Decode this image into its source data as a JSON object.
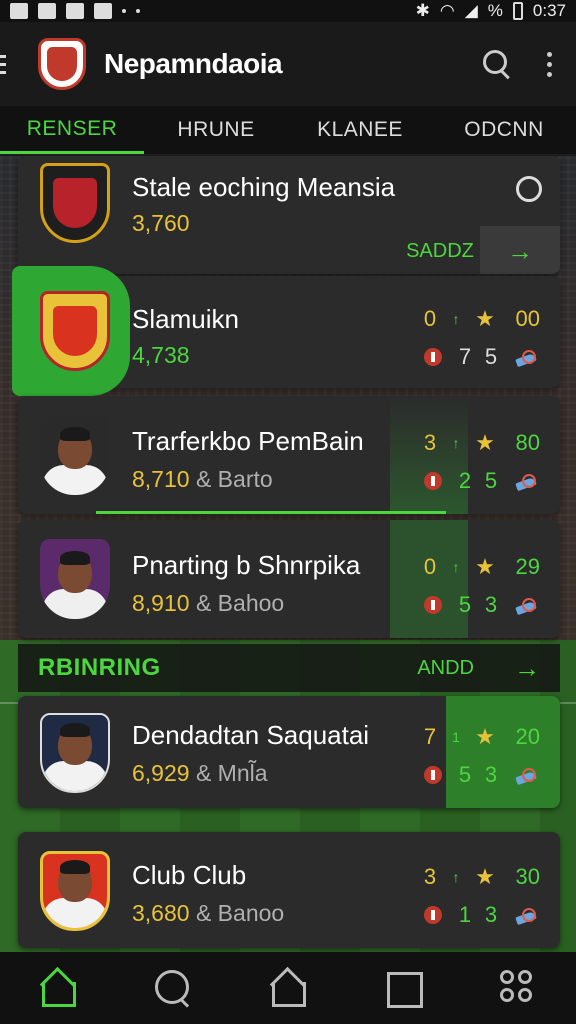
{
  "status_bar": {
    "time": "0:37",
    "battery_glyph": "%"
  },
  "app": {
    "title": "Nepamndaoia"
  },
  "colors": {
    "accent": "#4cd640",
    "gold": "#e8c33a",
    "card": "#2b2b2b",
    "red": "#c0392b"
  },
  "tabs": [
    {
      "label": "RENSER",
      "active": true
    },
    {
      "label": "HRUNE",
      "active": false
    },
    {
      "label": "KLANEE",
      "active": false
    },
    {
      "label": "ODCNN",
      "active": false
    }
  ],
  "cards": [
    {
      "name": "Stale eoching Meansia",
      "value": "3,760",
      "extra": "",
      "action_label": "SADDZ",
      "action_arrow": "→"
    },
    {
      "name": "Slamuikn",
      "value": "4,738",
      "extra": "",
      "top": {
        "a": "0",
        "b": "↑",
        "c": "00"
      },
      "bottom": {
        "a": "7",
        "b": "5"
      }
    },
    {
      "name": "Trarferkbo PemBain",
      "value": "8,710",
      "extra": "& Barto",
      "top": {
        "a": "3",
        "b": "↑",
        "c": "80"
      },
      "bottom": {
        "a": "2",
        "b": "5"
      }
    },
    {
      "name": "Pnarting b Shnrpika",
      "value": "8,910",
      "extra": "& Bahoo",
      "top": {
        "a": "0",
        "b": "↑",
        "c": "29"
      },
      "bottom": {
        "a": "5",
        "b": "3"
      }
    },
    {
      "name": "Dendadtan Saquatai",
      "value": "6,929",
      "extra": "& Mnl̃a",
      "top": {
        "a": "7",
        "b": "1",
        "c": "20"
      },
      "bottom": {
        "a": "5",
        "b": "3"
      }
    },
    {
      "name": "Club Club",
      "value": "3,680",
      "extra": "& Banoo",
      "top": {
        "a": "3",
        "b": "↑",
        "c": "30"
      },
      "bottom": {
        "a": "1",
        "b": "3"
      }
    }
  ],
  "section": {
    "title": "RBINRING",
    "action": "ANDD",
    "arrow": "→"
  },
  "star_glyph": "★",
  "bottom_nav": [
    "home-icon",
    "search-icon",
    "home-icon",
    "square-icon",
    "apps-icon"
  ]
}
